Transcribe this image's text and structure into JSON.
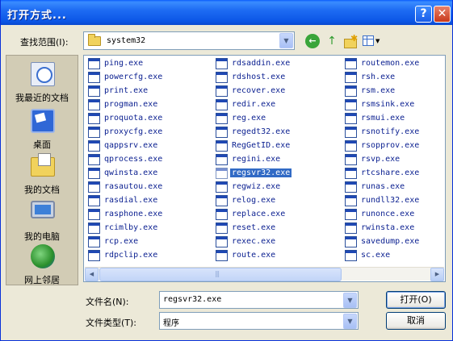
{
  "title": "打开方式...",
  "title_buttons": {
    "help": "?",
    "close": "✕"
  },
  "lookin": {
    "label": "查找范围(I):",
    "value": "system32"
  },
  "places": [
    {
      "label": "我最近的文档",
      "icon": "recent-docs-icon"
    },
    {
      "label": "桌面",
      "icon": "desktop-icon"
    },
    {
      "label": "我的文档",
      "icon": "my-docs-icon"
    },
    {
      "label": "我的电脑",
      "icon": "my-computer-icon"
    },
    {
      "label": "网上邻居",
      "icon": "network-icon"
    }
  ],
  "files": {
    "col1": [
      "ping.exe",
      "powercfg.exe",
      "print.exe",
      "progman.exe",
      "proquota.exe",
      "proxycfg.exe",
      "qappsrv.exe",
      "qprocess.exe",
      "qwinsta.exe",
      "rasautou.exe",
      "rasdial.exe",
      "rasphone.exe",
      "rcimlby.exe",
      "rcp.exe",
      "rdpclip.exe"
    ],
    "col2": [
      "rdsaddin.exe",
      "rdshost.exe",
      "recover.exe",
      "redir.exe",
      "reg.exe",
      "regedt32.exe",
      "RegGetID.exe",
      "regini.exe",
      "regsvr32.exe",
      "regwiz.exe",
      "relog.exe",
      "replace.exe",
      "reset.exe",
      "rexec.exe",
      "route.exe"
    ],
    "col3": [
      "routemon.exe",
      "rsh.exe",
      "rsm.exe",
      "rsmsink.exe",
      "rsmui.exe",
      "rsnotify.exe",
      "rsopprov.exe",
      "rsvp.exe",
      "rtcshare.exe",
      "runas.exe",
      "rundll32.exe",
      "runonce.exe",
      "rwinsta.exe",
      "savedump.exe",
      "sc.exe"
    ]
  },
  "selected_file": "regsvr32.exe",
  "filename": {
    "label": "文件名(N):",
    "value": "regsvr32.exe"
  },
  "filetype": {
    "label": "文件类型(T):",
    "value": "程序"
  },
  "buttons": {
    "open": "打开(O)",
    "cancel": "取消"
  },
  "colors": {
    "titlebar": "#0a5dfc",
    "selection": "#316ac5",
    "filename_text": "#0a1f90"
  }
}
